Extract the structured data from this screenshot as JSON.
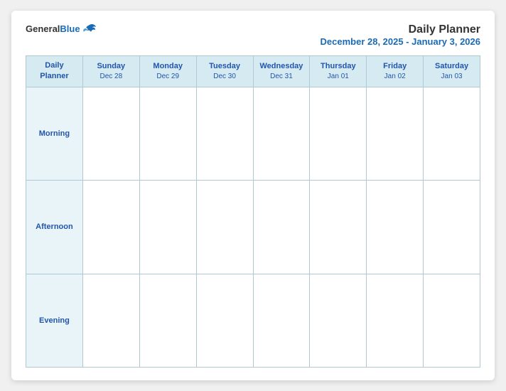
{
  "header": {
    "logo_general": "General",
    "logo_blue": "Blue",
    "title": "Daily Planner",
    "subtitle": "December 28, 2025 - January 3, 2026"
  },
  "columns": [
    {
      "day": "Daily Planner",
      "date": ""
    },
    {
      "day": "Sunday",
      "date": "Dec 28"
    },
    {
      "day": "Monday",
      "date": "Dec 29"
    },
    {
      "day": "Tuesday",
      "date": "Dec 30"
    },
    {
      "day": "Wednesday",
      "date": "Dec 31"
    },
    {
      "day": "Thursday",
      "date": "Jan 01"
    },
    {
      "day": "Friday",
      "date": "Jan 02"
    },
    {
      "day": "Saturday",
      "date": "Jan 03"
    }
  ],
  "rows": [
    {
      "label": "Morning"
    },
    {
      "label": "Afternoon"
    },
    {
      "label": "Evening"
    }
  ]
}
